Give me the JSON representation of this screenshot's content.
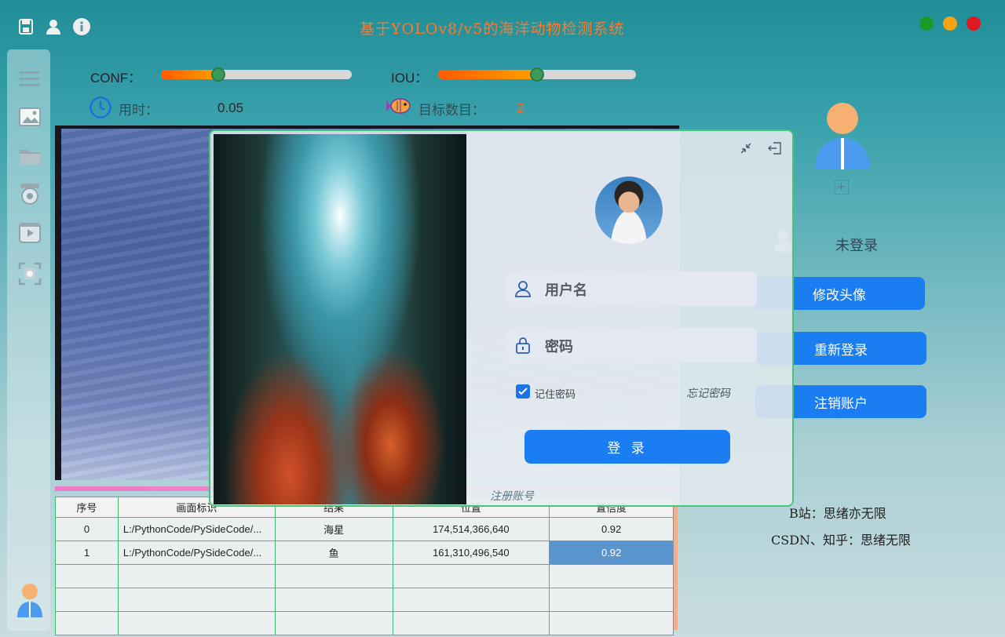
{
  "app": {
    "title": "基于YOLOv8/v5的海洋动物检测系统"
  },
  "window_controls": {
    "colors": [
      "#1a9a2a",
      "#f5a312",
      "#e01822"
    ]
  },
  "params": {
    "conf_label": "CONF：",
    "conf_value": 0.3,
    "iou_label": "IOU：",
    "iou_value": 0.5,
    "time_label": "用时：",
    "time_value": "0.05",
    "target_label": "目标数目：",
    "target_value": "2"
  },
  "table": {
    "headers": [
      "序号",
      "画面标识",
      "结果",
      "位置",
      "置信度"
    ],
    "rows": [
      [
        "0",
        "L:/PythonCode/PySideCode/...",
        "海星",
        "174,514,366,640",
        "0.92"
      ],
      [
        "1",
        "L:/PythonCode/PySideCode/...",
        "鱼",
        "161,310,496,540",
        "0.92"
      ]
    ]
  },
  "user_panel": {
    "status": "未登录",
    "buttons": [
      "修改头像",
      "重新登录",
      "注销账户"
    ],
    "bilibili": "B站：思绪亦无限",
    "csdn": "CSDN、知乎：思绪无限"
  },
  "login": {
    "username_placeholder": "用户名",
    "password_placeholder": "密码",
    "remember_label": "记住密码",
    "forgot_label": "忘记密码",
    "login_button": "登 录",
    "register_link": "注册账号"
  }
}
